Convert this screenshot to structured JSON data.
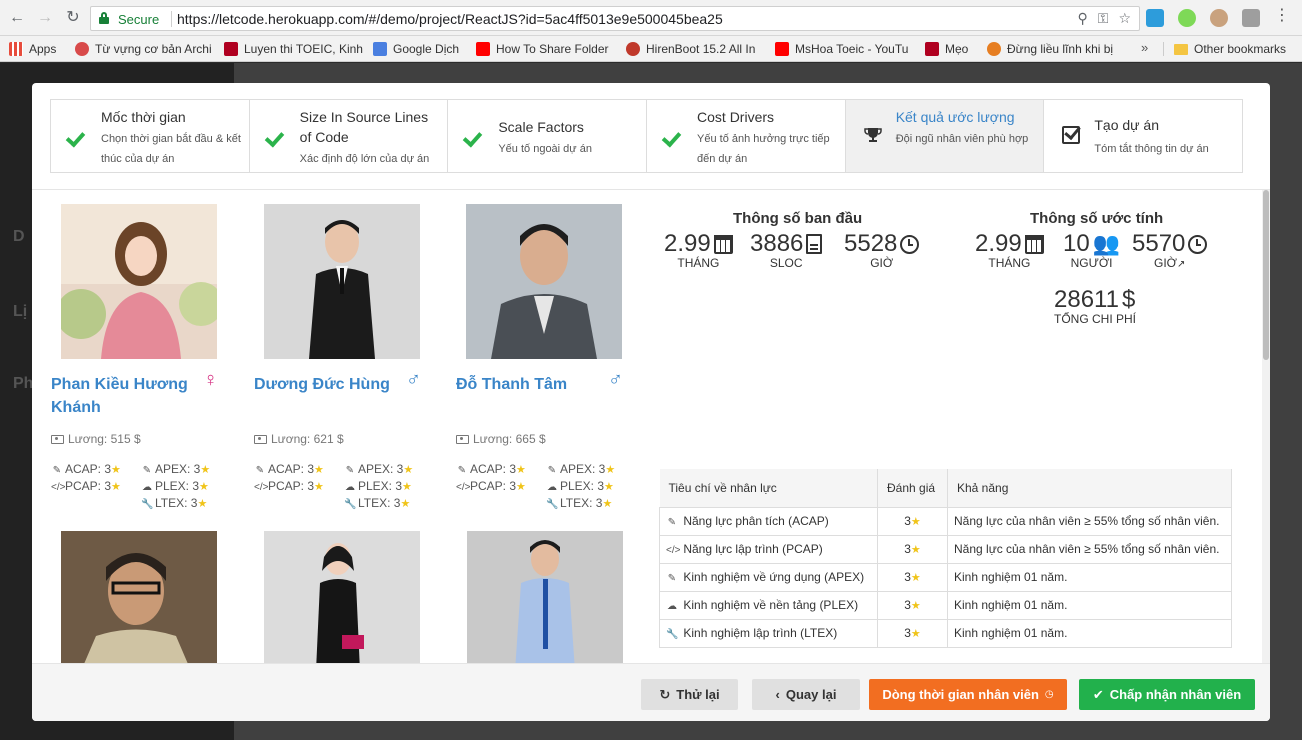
{
  "browser": {
    "secure_label": "Secure",
    "url": "https://letcode.herokuapp.com/#/demo/project/ReactJS?id=5ac4ff5013e9e500045bea25"
  },
  "bookmarks": {
    "items": [
      {
        "label": "Apps",
        "color": "#e74c3c"
      },
      {
        "label": "Từ vựng cơ bản Archi",
        "color": "#d84a4a"
      },
      {
        "label": "Luyen thi TOEIC, Kinh",
        "color": "#b00020"
      },
      {
        "label": "Google Dịch",
        "color": "#4a7fe0"
      },
      {
        "label": "How To Share Folder",
        "color": "#ff0000"
      },
      {
        "label": "HirenBoot 15.2 All In",
        "color": "#c0392b"
      },
      {
        "label": "MsHoa Toeic - YouTu",
        "color": "#ff0000"
      },
      {
        "label": "Mẹo",
        "color": "#b00020"
      },
      {
        "label": "Đừng liều lĩnh khi bị",
        "color": "#e67e22"
      }
    ],
    "more": "»",
    "other": "Other bookmarks"
  },
  "steps": [
    {
      "title": "Mốc thời gian",
      "desc": "Chọn thời gian bắt đầu & kết thúc của dự án",
      "state": "done"
    },
    {
      "title": "Size In Source Lines of Code",
      "desc": "Xác định độ lớn của dự án",
      "state": "done"
    },
    {
      "title": "Scale Factors",
      "desc": "Yếu tố ngoài dự án",
      "state": "done"
    },
    {
      "title": "Cost Drivers",
      "desc": "Yếu tố ảnh hưởng trực tiếp đến dự án",
      "state": "done"
    },
    {
      "title": "Kết quả ước lượng",
      "desc": "Đội ngũ nhân viên phù hợp",
      "state": "active"
    },
    {
      "title": "Tạo dự án",
      "desc": "Tóm tắt thông tin dự án",
      "state": "todo"
    }
  ],
  "people": [
    {
      "name": "Phan Kiều Hương Khánh",
      "gender": "♀",
      "salary": "Lương: 515 $",
      "acap": "ACAP: 3",
      "pcap": "PCAP: 3",
      "apex": "APEX: 3",
      "plex": "PLEX: 3",
      "ltex": "LTEX: 3"
    },
    {
      "name": "Dương Đức Hùng",
      "gender": "♂",
      "salary": "Lương: 621 $",
      "acap": "ACAP: 3",
      "pcap": "PCAP: 3",
      "apex": "APEX: 3",
      "plex": "PLEX: 3",
      "ltex": "LTEX: 3"
    },
    {
      "name": "Đỗ Thanh Tâm",
      "gender": "♂",
      "salary": "Lương: 665 $",
      "acap": "ACAP: 3",
      "pcap": "PCAP: 3",
      "apex": "APEX: 3",
      "plex": "PLEX: 3",
      "ltex": "LTEX: 3"
    }
  ],
  "initial": {
    "heading": "Thông số ban đầu",
    "months": "2.99",
    "months_label": "THÁNG",
    "sloc": "3886",
    "sloc_label": "SLOC",
    "hours": "5528",
    "hours_label": "GIỜ"
  },
  "estimate": {
    "heading": "Thông số ước tính",
    "months": "2.99",
    "months_label": "THÁNG",
    "people": "10",
    "people_label": "NGƯỜI",
    "hours": "5570",
    "hours_label": "GIỜ",
    "cost": "28611",
    "cost_unit": "$",
    "cost_label": "TỔNG CHI PHÍ"
  },
  "table": {
    "headers": [
      "Tiêu chí về nhân lực",
      "Đánh giá",
      "Khả năng"
    ],
    "rows": [
      {
        "icon": "pencil-icon",
        "criteria": "Năng lực phân tích (ACAP)",
        "rating": "3",
        "ability": "Năng lực của nhân viên ≥ 55% tổng số nhân viên."
      },
      {
        "icon": "code-icon",
        "criteria": "Năng lực lập trình (PCAP)",
        "rating": "3",
        "ability": "Năng lực của nhân viên ≥ 55% tổng số nhân viên."
      },
      {
        "icon": "edit-icon",
        "criteria": "Kinh nghiệm về ứng dụng (APEX)",
        "rating": "3",
        "ability": "Kinh nghiệm 01 năm."
      },
      {
        "icon": "cloud-icon",
        "criteria": "Kinh nghiệm về nền tảng (PLEX)",
        "rating": "3",
        "ability": "Kinh nghiệm 01 năm."
      },
      {
        "icon": "wrench-icon",
        "criteria": "Kinh nghiệm lập trình (LTEX)",
        "rating": "3",
        "ability": "Kinh nghiệm 01 năm."
      }
    ]
  },
  "footer": {
    "retry": "Thử lại",
    "back": "Quay lại",
    "timeline": "Dòng thời gian nhân viên",
    "accept": "Chấp nhận nhân viên"
  },
  "colors": {
    "accent": "#3a85c8",
    "success": "#22b14c",
    "warning": "#f26e21",
    "star": "#f0c419"
  }
}
